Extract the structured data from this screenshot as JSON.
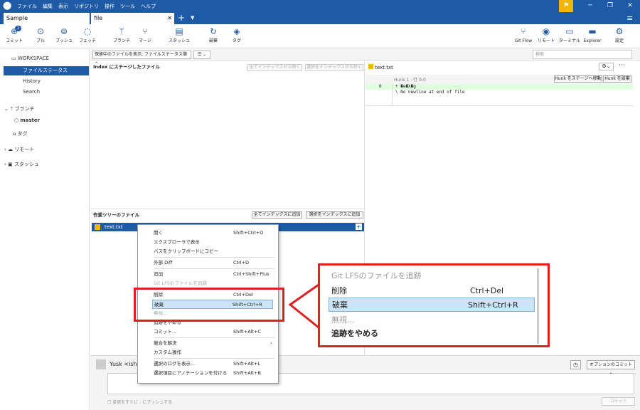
{
  "title_menu": [
    "ファイル",
    "編集",
    "表示",
    "リポジトリ",
    "操作",
    "ツール",
    "ヘルプ"
  ],
  "tabs": [
    {
      "label": "Sample"
    },
    {
      "label": "file"
    }
  ],
  "toolbar": {
    "left": [
      {
        "icon": "commit-icon",
        "label": "コミット"
      },
      {
        "icon": "pull-icon",
        "label": "プル"
      },
      {
        "icon": "push-icon",
        "label": "プッシュ"
      },
      {
        "icon": "fetch-icon",
        "label": "フェッチ"
      },
      {
        "icon": "branch-icon",
        "label": "ブランチ"
      },
      {
        "icon": "merge-icon",
        "label": "マージ"
      },
      {
        "icon": "stash-icon",
        "label": "スタッシュ"
      },
      {
        "icon": "discard-icon",
        "label": "破棄"
      },
      {
        "icon": "tag-icon",
        "label": "タグ"
      }
    ],
    "right": [
      {
        "icon": "gitflow-icon",
        "label": "Git Flow"
      },
      {
        "icon": "remote-icon",
        "label": "リモート"
      },
      {
        "icon": "terminal-icon",
        "label": "ターミナル"
      },
      {
        "icon": "explorer-icon",
        "label": "Explorer"
      },
      {
        "icon": "settings-icon",
        "label": "設定"
      }
    ],
    "badge": "1"
  },
  "sidebar": {
    "workspace": "WORKSPACE",
    "items": [
      "ファイルステータス",
      "History",
      "Search"
    ],
    "branches": "ブランチ",
    "master": "master",
    "tags": "タグ",
    "remote": "リモート",
    "stash": "スタッシュ"
  },
  "filter": {
    "select": "保留中のファイルを表示, ファイルステータス順",
    "search_placeholder": "検索"
  },
  "staged": {
    "title": "Index にステージしたファイル",
    "btn_unstage_all": "全てインデックスから除く",
    "btn_unstage_sel": "選択をインデックスから除く"
  },
  "working": {
    "title": "作業ツリーのファイル",
    "btn_add_all": "全てインデックスに追加",
    "btn_add_sel": "選択をインデックスに追加",
    "file": "text.txt"
  },
  "diff": {
    "file": "text.txt",
    "hunk": "Hunk 1 : 行 0-0",
    "btn_stage_hunk": "Hunk をステージへ移動",
    "btn_discard_hunk": "Hunk を破棄",
    "line_no": "0",
    "added_line": "+ �e�X�g",
    "no_newline": "\\  No newline at end of file"
  },
  "context_menu": [
    {
      "label": "開く",
      "key": "Shift+Ctrl+O"
    },
    {
      "label": "エクスプローラで表示",
      "key": ""
    },
    {
      "label": "パスをクリップボードにコピー",
      "key": ""
    },
    {
      "sep": true
    },
    {
      "label": "外部 Diff",
      "key": "Ctrl+D"
    },
    {
      "sep": true
    },
    {
      "label": "追加",
      "key": "Ctrl+Shift+Plus"
    },
    {
      "label": "Git LFSのファイルを追跡",
      "key": "",
      "dis": true
    },
    {
      "sep": true
    },
    {
      "label": "削除",
      "key": "Ctrl+Del"
    },
    {
      "label": "破棄",
      "key": "Shift+Ctrl+R",
      "sel": true
    },
    {
      "label": "無視...",
      "key": "",
      "dis": true
    },
    {
      "label": "追跡をやめる",
      "key": ""
    },
    {
      "label": "コミット...",
      "key": "Shift+Alt+C"
    },
    {
      "sep": true
    },
    {
      "label": "競合を解決",
      "key": "",
      "arrow": true
    },
    {
      "label": "カスタム操作",
      "key": ""
    },
    {
      "sep": true
    },
    {
      "label": "選択のログを表示...",
      "key": "Shift+Alt+L"
    },
    {
      "label": "選択項目にアノテーションを付ける",
      "key": "Shift+Alt+B"
    }
  ],
  "zoom_menu": [
    {
      "label": "Git LFSのファイルを追跡",
      "key": "",
      "dis": true
    },
    {
      "label": "削除",
      "key": "Ctrl+Del"
    },
    {
      "label": "破棄",
      "key": "Shift+Ctrl+R",
      "sel": true
    },
    {
      "label": "無視...",
      "key": "",
      "dis": true
    },
    {
      "label": "追跡をやめる",
      "key": ""
    }
  ],
  "commit": {
    "author": "Yusk <ishig",
    "options": "オプションのコミット",
    "push_label": "変更をすぐに - にプッシュする",
    "commit_btn": "コミット"
  },
  "colors": {
    "accent": "#1f5aa6",
    "highlight": "#e02020",
    "added": "#dfffdf"
  }
}
